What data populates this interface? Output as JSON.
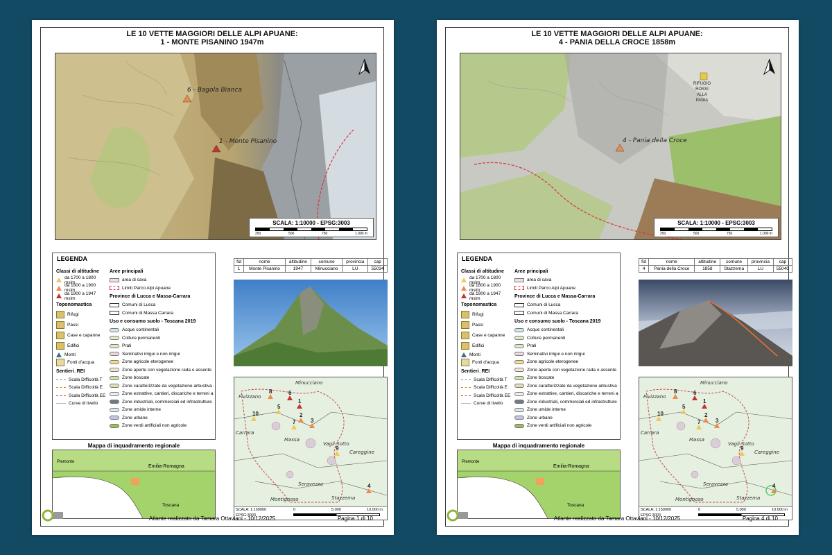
{
  "pages": [
    {
      "title_line1": "LE 10 VETTE MAGGIORI DELLE ALPI APUANE:",
      "title_line2": "1 - MONTE PISANINO 1947m",
      "peak_labels": [
        "6 - Bagola Bianca",
        "1 - Monte Pisanino"
      ],
      "scale_title": "SCALA: 1:10000 - EPSG:3003",
      "scale_ticks": [
        "250",
        "500",
        "750",
        "1.000 m"
      ],
      "table": {
        "headers": [
          "fid",
          "nome",
          "altitudine",
          "comune",
          "provincia",
          "cap"
        ],
        "row": [
          "1",
          "Monte Pisanino",
          "1947",
          "Minucciano",
          "LU",
          "55034"
        ]
      },
      "footer_center": "Atlante realizzato da Tamara Ottaviani - 10/12/2025",
      "footer_page": "Pagina 1 di 10"
    },
    {
      "title_line1": "LE 10 VETTE MAGGIORI DELLE ALPI APUANE:",
      "title_line2": "4 - PANIA DELLA CROCE 1858m",
      "peak_labels": [
        "4 - Pania della Croce"
      ],
      "hut_label": [
        "RIFUGIO",
        "ROSSI",
        "ALLA",
        "PANIA"
      ],
      "scale_title": "SCALA: 1:10000 - EPSG:3003",
      "scale_ticks": [
        "250",
        "500",
        "750",
        "1.000 m"
      ],
      "table": {
        "headers": [
          "fid",
          "nome",
          "altitudine",
          "comune",
          "provincia",
          "cap"
        ],
        "row": [
          "4",
          "Pania della Croce",
          "1858",
          "Stazzema",
          "LU",
          "55040"
        ]
      },
      "footer_center": "Atlante realizzato da Tamara Ottaviani - 10/12/2025",
      "footer_page": "Pagina 4 di 10"
    }
  ],
  "legend": {
    "title": "LEGENDA",
    "altitude_title": "Classi di altitudine",
    "altitude": [
      "da 1700 a 1800 mslm",
      "da 1800 a 1900 mslm",
      "da 1900 a 1947 mslm"
    ],
    "toponym_title": "Toponomastica",
    "toponyms": [
      "Rifugi",
      "Passi",
      "Case e capanne",
      "Edifici",
      "Monti",
      "Fonti d'acqua"
    ],
    "trails_title": "Sentieri_REI",
    "trails": [
      "Scala Difficoltà T",
      "Scala Difficoltà E",
      "Scala Difficoltà EE",
      "Curve di livello"
    ],
    "areas_title": "Aree principali",
    "areas": [
      "area di cava",
      "Limiti Parco Alpi Apuane"
    ],
    "prov_title": "Province di Lucca e Massa-Carrara",
    "provinces": [
      "Comuni di Lucca",
      "Comuni di Massa Carrara"
    ],
    "landuse_title": "Uso e consumo suolo - Toscana 2019",
    "landuse": [
      "Acque continentali",
      "Colture permanenti",
      "Prati",
      "Seminativi irrigui e non irrigui",
      "Zone agricole eterogenee",
      "Zone aperte con vegetazione rada o assente",
      "Zone boscate",
      "Zone caratterizzate da vegetazione arbustiva e/o erbacea",
      "Zone estrattive, cantieri, discariche e terreni artefatti",
      "Zone industriali, commerciali ed infrastrutture",
      "Zone umide interne",
      "Zone urbane",
      "Zone verdi artificiali non agricole"
    ]
  },
  "overview": {
    "places": [
      "Minucciano",
      "Fivizzano",
      "Carrara",
      "Massa",
      "Vagli Sotto",
      "Careggine",
      "Seravezza",
      "Montignoso",
      "Stazzema"
    ],
    "peaks": [
      "1",
      "2",
      "3",
      "4",
      "5",
      "6",
      "7",
      "8",
      "9",
      "10"
    ],
    "scale_text": "SCALA: 1:150000",
    "epsg": "EPSG:3003",
    "ticks": [
      "0",
      "5.000",
      "10.000 m"
    ]
  },
  "regional": {
    "title": "Mappa di inquadramento regionale",
    "labels": [
      "Piemonte",
      "Emilia-Romagna",
      "Toscana"
    ]
  },
  "colors": {
    "background": "#134a63",
    "peak_low": "#f1c65a",
    "peak_mid": "#f08a4b",
    "peak_high": "#c8322a",
    "park_boundary": "#d9343c"
  }
}
